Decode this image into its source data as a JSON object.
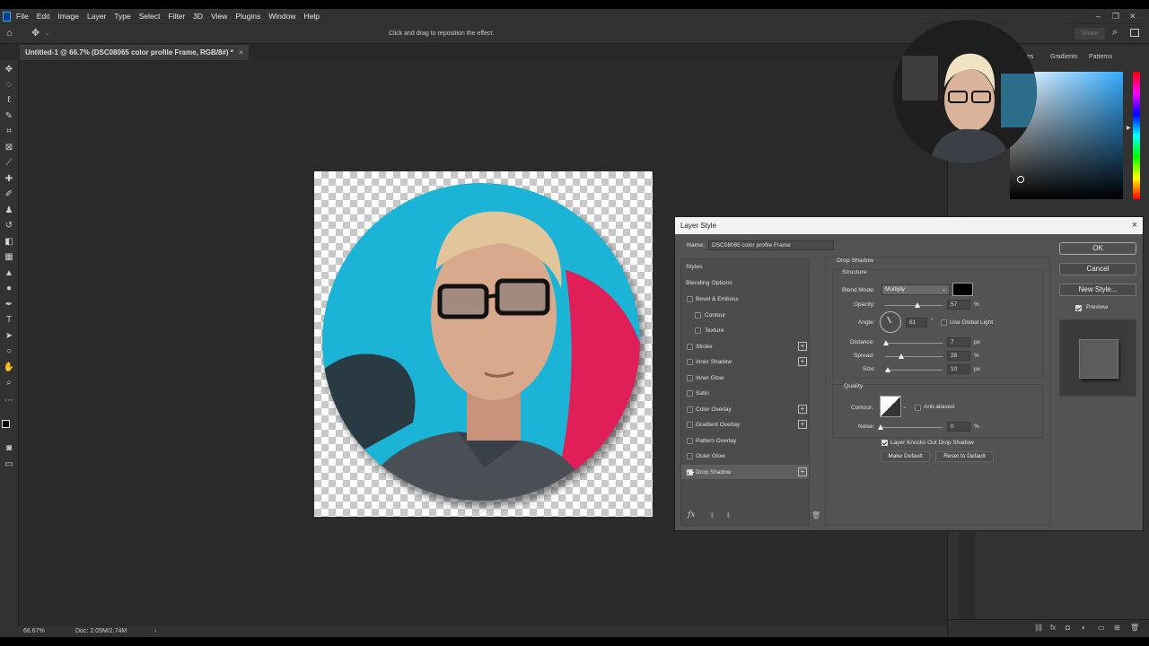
{
  "menubar": {
    "items": [
      "File",
      "Edit",
      "Image",
      "Layer",
      "Type",
      "Select",
      "Filter",
      "3D",
      "View",
      "Plugins",
      "Window",
      "Help"
    ]
  },
  "options_bar": {
    "hint": "Click and drag to reposition the effect.",
    "share_label": "Share"
  },
  "document": {
    "tab_title": "Untitled-1 @ 66.7% (DSC08065 color profile Frame, RGB/8#) *",
    "tab_close": "×"
  },
  "status": {
    "zoom": "66.67%",
    "doc": "Doc: 2.05M/2.74M",
    "arrow": "›"
  },
  "panels": {
    "tabs": [
      "...es",
      "Gradients",
      "Patterns"
    ]
  },
  "colors": {
    "ps_blue": "#31a8ff",
    "dialog_bg": "#535353",
    "picker_hue": "#33aaff"
  },
  "dialog": {
    "title": "Layer Style",
    "close": "×",
    "name_label": "Name:",
    "name_value": "DSC08065 color profile Frame",
    "styles_header": "Styles",
    "blending_options": "Blending Options",
    "effects": [
      {
        "label": "Bevel & Emboss",
        "checked": false,
        "plus": false,
        "indent": false
      },
      {
        "label": "Contour",
        "checked": false,
        "plus": false,
        "indent": true
      },
      {
        "label": "Texture",
        "checked": false,
        "plus": false,
        "indent": true
      },
      {
        "label": "Stroke",
        "checked": false,
        "plus": true,
        "indent": false
      },
      {
        "label": "Inner Shadow",
        "checked": false,
        "plus": true,
        "indent": false
      },
      {
        "label": "Inner Glow",
        "checked": false,
        "plus": false,
        "indent": false
      },
      {
        "label": "Satin",
        "checked": false,
        "plus": false,
        "indent": false
      },
      {
        "label": "Color Overlay",
        "checked": false,
        "plus": true,
        "indent": false
      },
      {
        "label": "Gradient Overlay",
        "checked": false,
        "plus": true,
        "indent": false
      },
      {
        "label": "Pattern Overlay",
        "checked": false,
        "plus": false,
        "indent": false
      },
      {
        "label": "Outer Glow",
        "checked": false,
        "plus": false,
        "indent": false
      },
      {
        "label": "Drop Shadow",
        "checked": true,
        "plus": true,
        "indent": false
      }
    ],
    "section_title": "Drop Shadow",
    "structure_label": "Structure",
    "blend_mode_label": "Blend Mode:",
    "blend_mode_value": "Multiply",
    "shadow_color": "#000000",
    "opacity": {
      "label": "Opacity:",
      "value": "57",
      "unit": "%",
      "fraction": 0.57
    },
    "angle": {
      "label": "Angle:",
      "value": "61",
      "unit": "°",
      "global_light_label": "Use Global Light",
      "global_light": false
    },
    "distance": {
      "label": "Distance:",
      "value": "7",
      "unit": "px",
      "fraction": 0.02
    },
    "spread": {
      "label": "Spread:",
      "value": "28",
      "unit": "%",
      "fraction": 0.28
    },
    "size": {
      "label": "Size:",
      "value": "10",
      "unit": "px",
      "fraction": 0.04
    },
    "quality_label": "Quality",
    "contour_label": "Contour:",
    "anti_aliased_label": "Anti-aliased",
    "anti_aliased": false,
    "noise": {
      "label": "Noise:",
      "value": "0",
      "unit": "%",
      "fraction": 0
    },
    "knockout_label": "Layer Knocks Out Drop Shadow",
    "knockout": true,
    "make_default": "Make Default",
    "reset_default": "Reset to Default",
    "fx_label": "fx",
    "ok": "OK",
    "cancel": "Cancel",
    "new_style": "New Style...",
    "preview_label": "Preview",
    "preview": true
  }
}
